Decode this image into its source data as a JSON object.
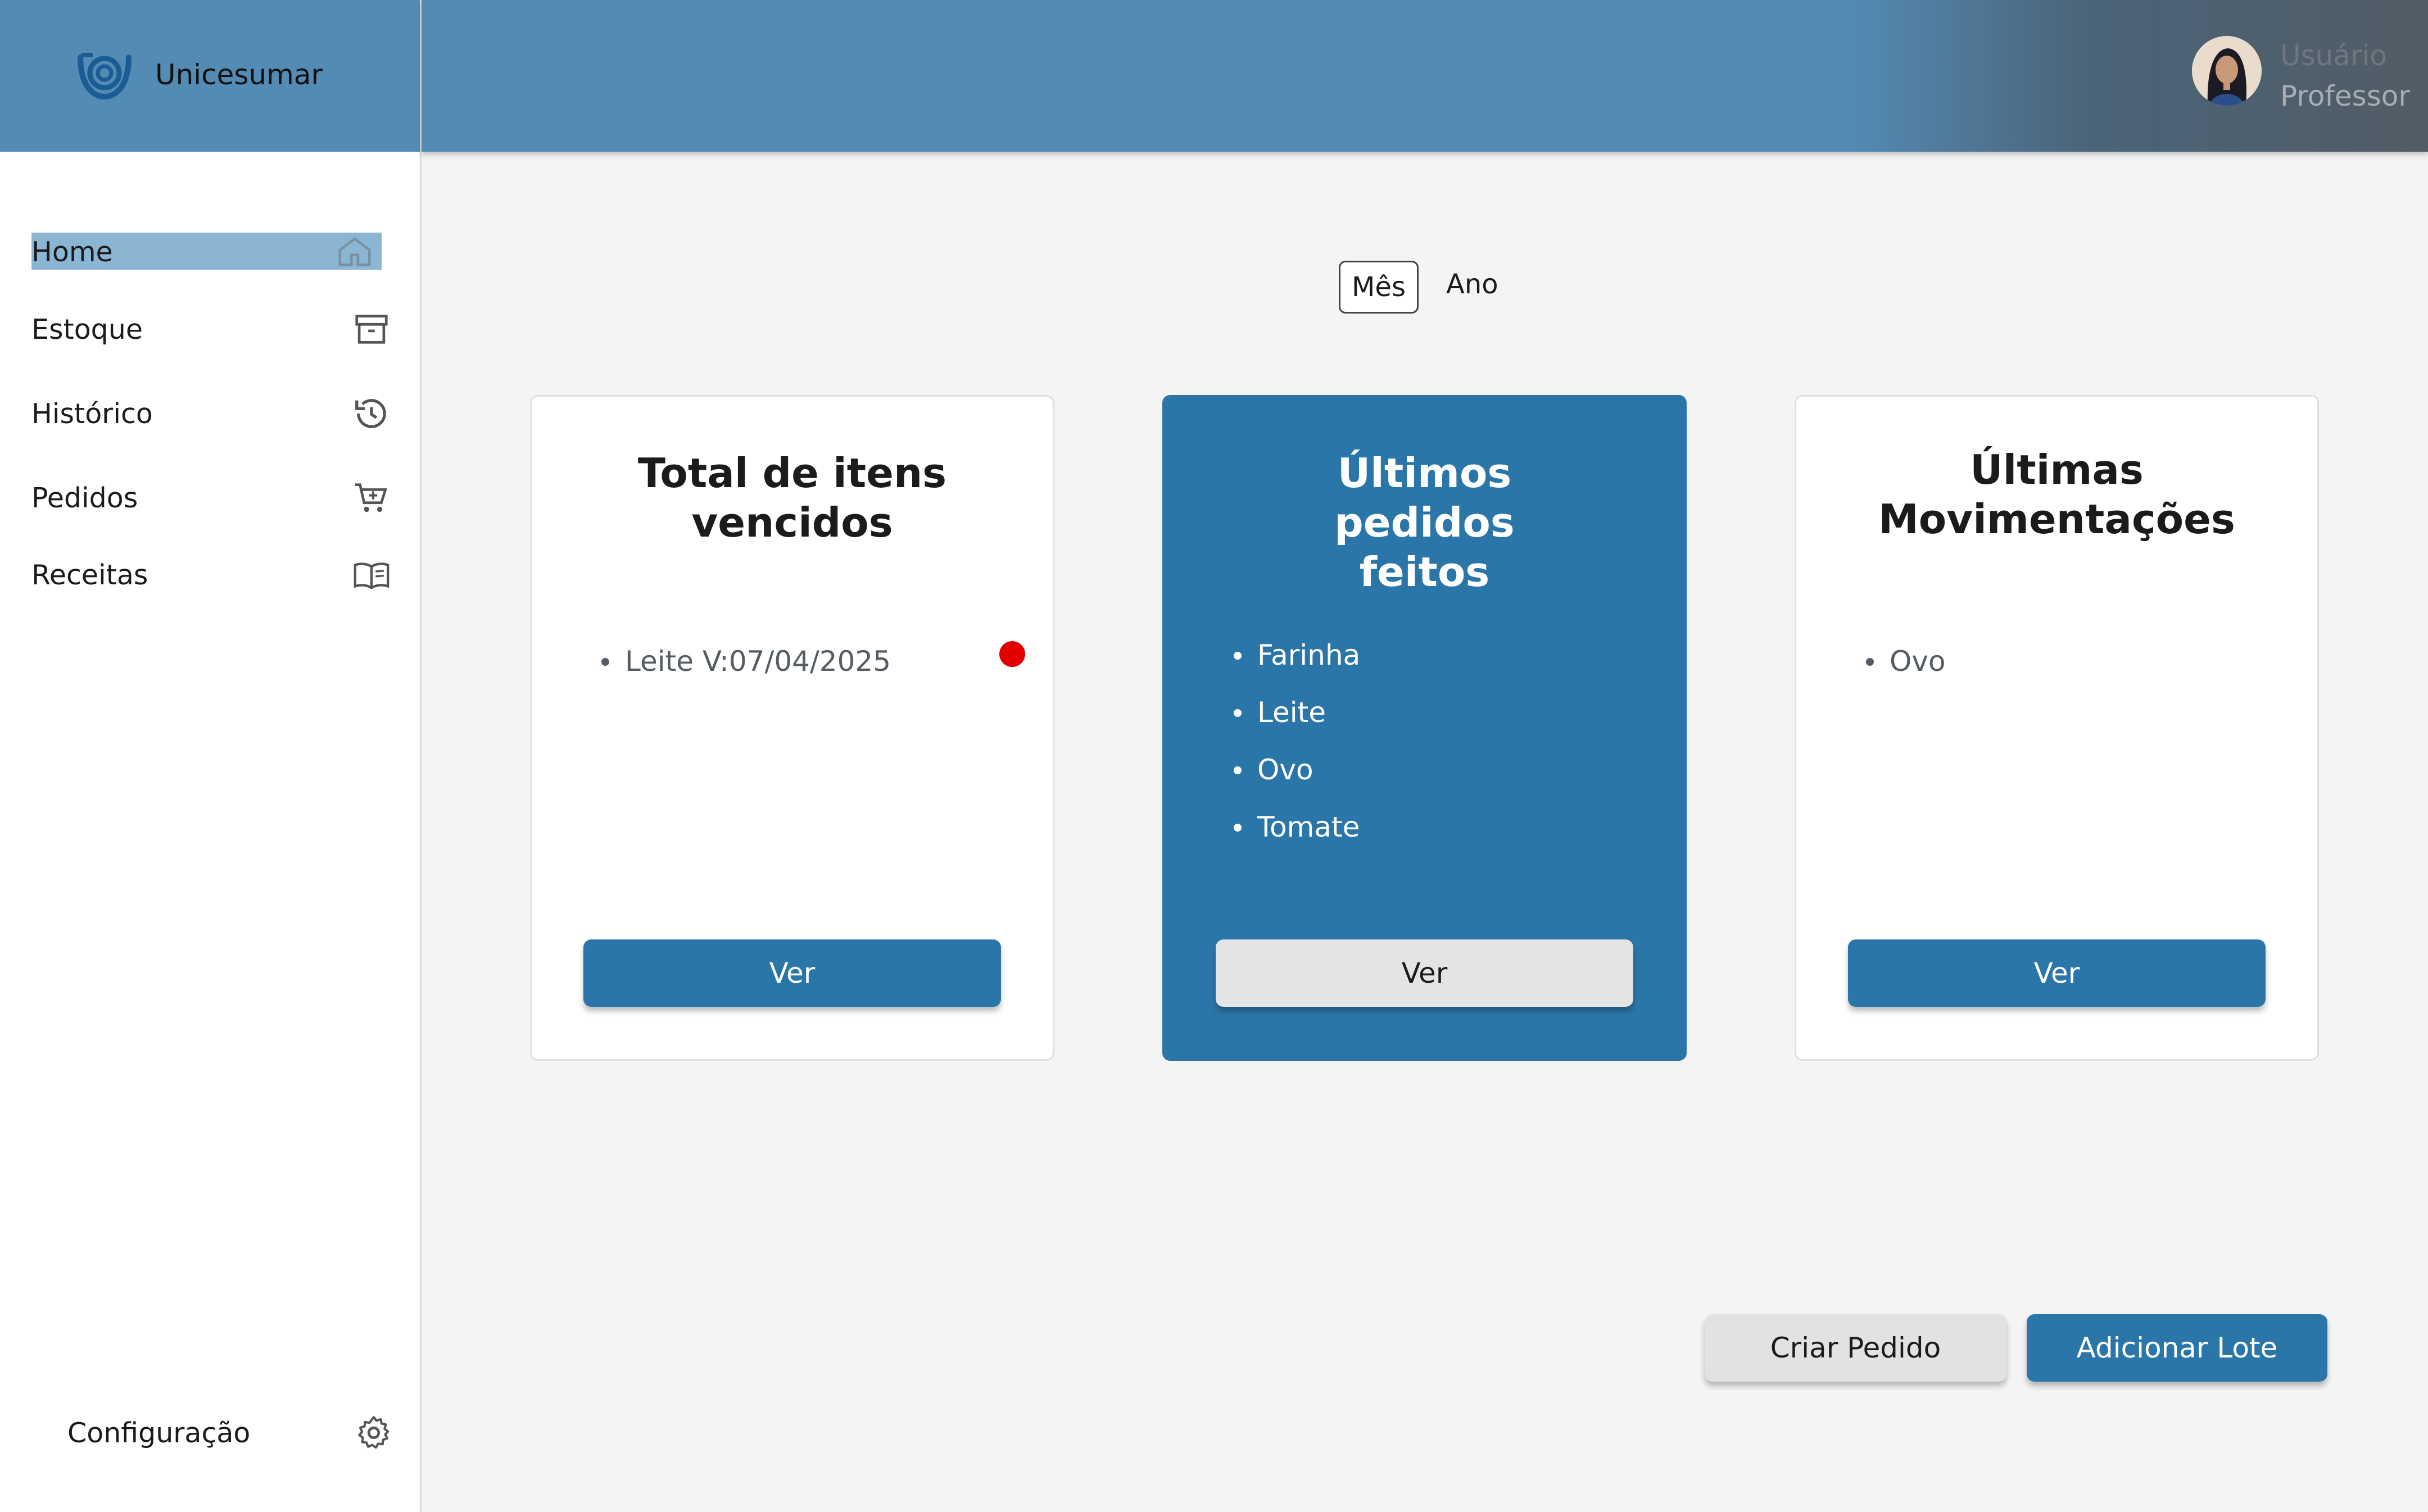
{
  "brand": {
    "name": "Unicesumar",
    "logo_icon": "unicesumar-logo-icon"
  },
  "sidebar": {
    "items": [
      {
        "label": "Home",
        "icon": "home-icon",
        "active": true
      },
      {
        "label": "Estoque",
        "icon": "archive-box-icon"
      },
      {
        "label": "Histórico",
        "icon": "history-icon"
      },
      {
        "label": "Pedidos",
        "icon": "cart-icon"
      },
      {
        "label": "Receitas",
        "icon": "book-icon"
      }
    ],
    "config": {
      "label": "Configuração",
      "icon": "gear-icon"
    }
  },
  "header": {
    "user_name": "Usuário",
    "user_role": "Professor"
  },
  "period": {
    "month_label": "Mês",
    "year_label": "Ano",
    "selected": "Mês"
  },
  "cards": [
    {
      "title_lines": [
        "Total de itens",
        "vencidos"
      ],
      "items": [
        "Leite V:07/04/2025"
      ],
      "status_color": "#e00000",
      "button_label": "Ver"
    },
    {
      "title_lines": [
        "Últimos",
        "pedidos",
        "feitos"
      ],
      "items": [
        "Farinha",
        "Leite",
        "Ovo",
        "Tomate"
      ],
      "button_label": "Ver"
    },
    {
      "title_lines": [
        "Últimas",
        "Movimentações"
      ],
      "items": [
        "Ovo"
      ],
      "button_label": "Ver"
    }
  ],
  "actions": {
    "criar_pedido": "Criar Pedido",
    "adicionar_lote": "Adicionar Lote"
  },
  "colors": {
    "primary": "#2b76a8",
    "header": "#538bb4",
    "highlight": "#8ab6d4",
    "alert": "#e00000"
  }
}
